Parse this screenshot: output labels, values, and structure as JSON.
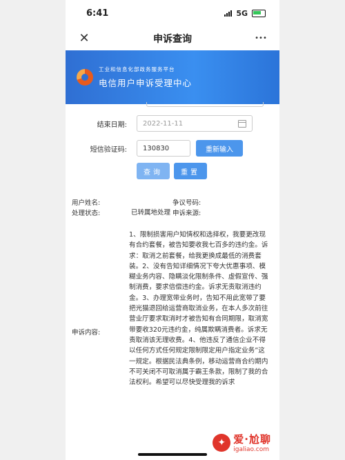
{
  "status_bar": {
    "time": "6:41",
    "network": "5G"
  },
  "nav": {
    "title": "申诉查询",
    "close_glyph": "✕",
    "more_glyph": "•••"
  },
  "banner": {
    "subtitle": "工业和信息化部政务服务平台",
    "title": "电信用户申诉受理中心"
  },
  "form": {
    "end_date_label": "结束日期:",
    "end_date_placeholder": "2022-11-11",
    "sms_code_label": "短信验证码:",
    "sms_code_value": "130830",
    "reenter_button": "重新输入",
    "query_button": "查询",
    "reset_button": "重置"
  },
  "details": {
    "user_name_label": "用户姓名:",
    "dispute_no_label": "争议号码:",
    "status_label": "处理状态:",
    "status_value": "已转属地处理",
    "source_label": "申诉来源:",
    "content_label": "申诉内容:",
    "content_text": "1、限制损害用户知情权和选择权，我要更改现有合约套餐，被告知要收我七百多的违约金。诉求：取消之前套餐，给我更换成最低的消费套装。2、没有告知详细情况下夸大优惠事项、模糊业务内容、隐瞒淡化限制条件、虚假宣传、强制消费，要求倍偿违约金。诉求无责取消违约金。3、办理宽带业务时，告知不用此宽带了要把光猫退回给运营商取消业务，在本人多次前往营业厅要求取消时才被告知有合同期限，取消宽带要收320元违约金，纯属欺瞒消费者。诉求无责取消该无理收费。4、他违反了通信企业不得以任何方式任何规定限制限定用户指定业务”这一规定。根据民法典条例，移动运营商合约期内不可关闭不可取消属于霸王条款，限制了我的合法权利。希望可以尽快受理我的诉求"
  },
  "watermark": {
    "title": "爱·尬聊",
    "url": "igaliao.com"
  },
  "colors": {
    "accent": "#4c96ec",
    "banner": "#3a8ff0",
    "watermark": "#e0352b"
  }
}
